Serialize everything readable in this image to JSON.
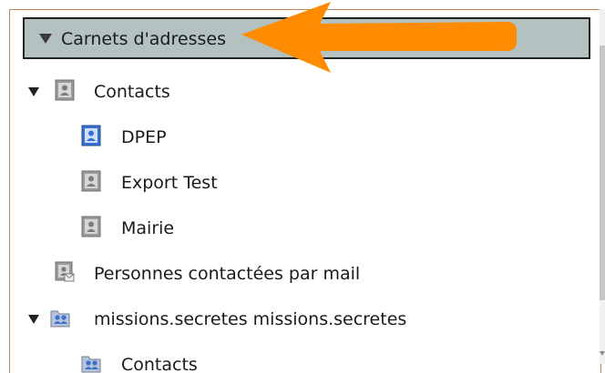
{
  "header": {
    "label": "Carnets d'adresses"
  },
  "tree": {
    "contacts": "Contacts",
    "dpep": "DPEP",
    "export_test": "Export Test",
    "mairie": "Mairie",
    "personnes": "Personnes contactées par mail",
    "missions": "missions.secretes missions.secretes",
    "missions_contacts": "Contacts"
  },
  "colors": {
    "accent_arrow": "#ff8c00",
    "header_bg": "#b3c1c1",
    "book_gray": "#9a9a9a",
    "book_blue": "#3a6fd0"
  }
}
